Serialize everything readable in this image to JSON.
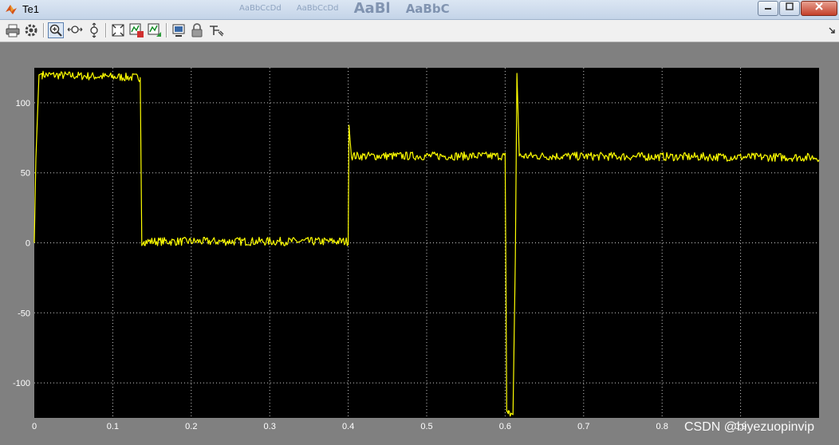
{
  "window": {
    "title": "Te1",
    "buttons": [
      "minimize",
      "maximize",
      "close"
    ],
    "background_ribbon_text": [
      "AaBbCcDd",
      "AaBbCcDd",
      "AaBl",
      "AaBbC"
    ]
  },
  "toolbar": {
    "buttons": [
      {
        "name": "print-icon",
        "tooltip": "Print"
      },
      {
        "name": "parameters-icon",
        "tooltip": "Parameters"
      },
      {
        "name": "zoom-in-icon",
        "tooltip": "Zoom",
        "pressed": true
      },
      {
        "name": "zoom-x-axis-icon",
        "tooltip": "Zoom X-axis"
      },
      {
        "name": "zoom-y-axis-icon",
        "tooltip": "Zoom Y-axis"
      },
      {
        "name": "autoscale-icon",
        "tooltip": "Autoscale"
      },
      {
        "name": "save-axes-settings-icon",
        "tooltip": "Save axes settings"
      },
      {
        "name": "restore-axes-settings-icon",
        "tooltip": "Restore axes settings"
      },
      {
        "name": "floating-scope-icon",
        "tooltip": "Floating scope"
      },
      {
        "name": "lock-axes-icon",
        "tooltip": "Lock axes selection"
      },
      {
        "name": "signal-selection-icon",
        "tooltip": "Signal selection"
      }
    ]
  },
  "colors": {
    "axes_background": "#000000",
    "figure_background": "#808080",
    "trace": "#ffff00",
    "grid": "#ffffff",
    "tick_text": "#ffffff"
  },
  "chart_data": {
    "type": "line",
    "title": "",
    "xlabel": "",
    "ylabel": "",
    "xlim": [
      0,
      1
    ],
    "ylim": [
      -125,
      125
    ],
    "xticks": [
      0,
      0.1,
      0.2,
      0.3,
      0.4,
      0.5,
      0.6,
      0.7,
      0.8,
      0.9
    ],
    "xtick_labels": [
      "0",
      "0.1",
      "0.2",
      "0.3",
      "0.4",
      "0.5",
      "0.6",
      "0.7",
      "0.8",
      "0.9"
    ],
    "yticks": [
      -100,
      -50,
      0,
      50,
      100
    ],
    "ytick_labels": [
      "-100",
      "-50",
      "0",
      "50",
      "100"
    ],
    "grid": true,
    "grid_style": "dotted",
    "series": [
      {
        "color": "#ffff00",
        "ripple": 3,
        "segments": [
          {
            "x": [
              0,
              0.002,
              0.006,
              0.01
            ],
            "y": [
              0,
              60,
              120,
              121
            ]
          },
          {
            "x": [
              0.01,
              0.135
            ],
            "y": [
              120,
              118
            ]
          },
          {
            "x": [
              0.135,
              0.137,
              0.14
            ],
            "y": [
              118,
              -2,
              1
            ]
          },
          {
            "x": [
              0.14,
              0.4
            ],
            "y": [
              1,
              1
            ]
          },
          {
            "x": [
              0.4,
              0.401,
              0.404
            ],
            "y": [
              1,
              84,
              62
            ]
          },
          {
            "x": [
              0.404,
              0.6
            ],
            "y": [
              62,
              62
            ]
          },
          {
            "x": [
              0.6,
              0.602,
              0.604
            ],
            "y": [
              62,
              -120,
              -122
            ]
          },
          {
            "x": [
              0.604,
              0.61
            ],
            "y": [
              -122,
              -122
            ]
          },
          {
            "x": [
              0.61,
              0.613,
              0.615,
              0.618
            ],
            "y": [
              -122,
              -10,
              121,
              62
            ]
          },
          {
            "x": [
              0.618,
              1.0
            ],
            "y": [
              62,
              61
            ]
          }
        ]
      }
    ],
    "annotations": []
  },
  "watermark": {
    "text": "CSDN @biyezuopinvip"
  }
}
